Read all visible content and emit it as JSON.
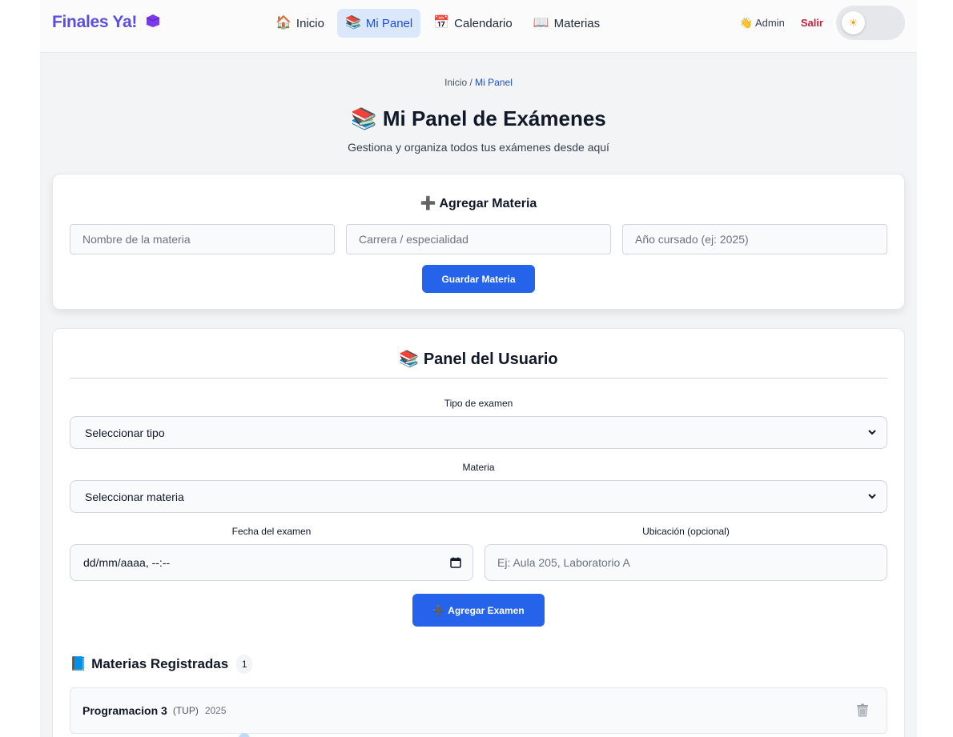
{
  "nav": {
    "brand": "Finales Ya!",
    "links": [
      {
        "icon": "house-icon",
        "glyph": "🏠",
        "label": "Inicio",
        "active": false
      },
      {
        "icon": "books-icon",
        "glyph": "📚",
        "label": "Mi Panel",
        "active": true
      },
      {
        "icon": "calendar-icon",
        "glyph": "📅",
        "label": "Calendario",
        "active": false
      },
      {
        "icon": "open-book-icon",
        "glyph": "📖",
        "label": "Materias",
        "active": false
      }
    ],
    "user_glyph": "👋",
    "user": "Admin",
    "logout": "Salir",
    "theme_toggle_glyph": "☀"
  },
  "breadcrumb": {
    "home": "Inicio",
    "separator": "/",
    "current": "Mi Panel"
  },
  "header": {
    "title_glyph": "📚",
    "title": "Mi Panel de Exámenes",
    "subtitle": "Gestiona y organiza todos tus exámenes desde aquí"
  },
  "add_subject": {
    "title_glyph": "➕",
    "title": "Agregar Materia",
    "name_placeholder": "Nombre de la materia",
    "career_placeholder": "Carrera / especialidad",
    "year_placeholder": "Año cursado (ej: 2025)",
    "save_label": "Guardar Materia"
  },
  "user_panel": {
    "title_glyph": "📚",
    "title": "Panel del Usuario",
    "exam_type_label": "Tipo de examen",
    "exam_type_value": "Seleccionar tipo",
    "subject_label": "Materia",
    "subject_value": "Seleccionar materia",
    "date_label": "Fecha del examen",
    "date_value": "dd/mm/aaaa, --:--",
    "location_label": "Ubicación (opcional)",
    "location_placeholder": "Ej: Aula 205, Laboratorio A",
    "add_exam_glyph": "➕",
    "add_exam_label": "Agregar Examen"
  },
  "registered": {
    "glyph": "📘",
    "title": "Materias Registradas",
    "count": "1",
    "items": [
      {
        "name": "Programacion 3",
        "career": "(TUP)",
        "year": "2025"
      }
    ]
  },
  "colors": {
    "accent": "#2563eb",
    "brand": "#5b4fe0",
    "logout": "#c81e3a",
    "active_tab_bg": "#dbe8fb"
  }
}
